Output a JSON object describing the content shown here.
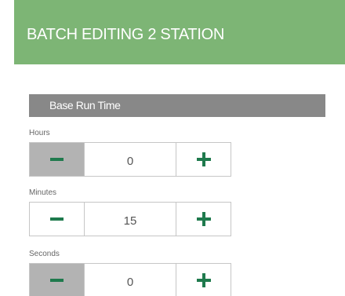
{
  "header": {
    "title": "BATCH EDITING 2 STATION",
    "background_color": "#7db575"
  },
  "section": {
    "title": "Base Run Time",
    "background_color": "#888888"
  },
  "fields": {
    "hours": {
      "label": "Hours",
      "value": "0",
      "minus_icon": "minus-icon",
      "plus_icon": "plus-icon",
      "minus_disabled": true
    },
    "minutes": {
      "label": "Minutes",
      "value": "15",
      "minus_icon": "minus-icon",
      "plus_icon": "plus-icon",
      "minus_disabled": false
    },
    "seconds": {
      "label": "Seconds",
      "value": "0",
      "minus_icon": "minus-icon",
      "plus_icon": "plus-icon",
      "minus_disabled": true
    }
  },
  "colors": {
    "accent_green": "#1f7a4d",
    "disabled_gray": "#b3b3b3"
  }
}
